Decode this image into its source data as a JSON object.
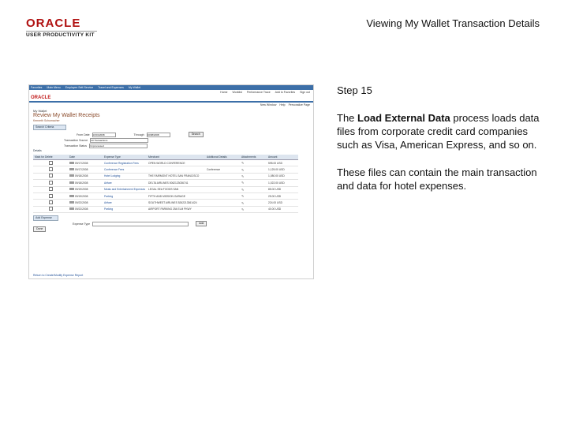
{
  "header": {
    "logo_brand": "ORACLE",
    "logo_sub": "USER PRODUCTIVITY KIT",
    "title": "Viewing My Wallet Transaction Details"
  },
  "side_text": {
    "step": "Step 15",
    "p1_pre": "The ",
    "p1_bold": "Load External Data",
    "p1_post": " process loads data files from corporate credit card companies such as Visa, American Express, and so on.",
    "p2": "These files can contain the main transaction and data for hotel expenses."
  },
  "screenshot": {
    "top_menu": [
      "Favorites",
      "Main Menu",
      "Employee Self-Service",
      "Travel and Expenses",
      "My Wallet"
    ],
    "top_links": [
      "Home",
      "Worklist",
      "Performance Trace",
      "Add to Favorites",
      "Sign out"
    ],
    "brand": "ORACLE",
    "page_links": [
      "New Window",
      "Help",
      "Personalize Page"
    ],
    "crumb": "My Wallet",
    "page_title": "Review My Wallet Receipts",
    "subtitle": "Kenneth Schumacher",
    "search_section": "Search Criteria",
    "from_date_label": "From Date",
    "from_date_value": "10/01/2008",
    "through_label": "Through",
    "through_value": "10/08/2008",
    "search_button": "Search",
    "transaction_source_label": "Transaction Source",
    "transaction_source_value": "All Transactions",
    "transaction_status_label": "Transaction Status",
    "transaction_status_value": "Unprocessed",
    "details_label": "Details",
    "columns": [
      "Mark for Delete",
      "Date",
      "Expense Type",
      "Merchant",
      "Additional Details",
      "Attachments",
      "Amount"
    ],
    "rows": [
      {
        "date": "09/17/2008",
        "type": "Conference Registration Fees",
        "merchant": "OPEN WORLD CONFERENCE",
        "details": "",
        "amount": "595.00 USD"
      },
      {
        "date": "09/17/2008",
        "type": "Conference Fees",
        "merchant": "",
        "details": "Conference",
        "amount": "1,125.00 USD"
      },
      {
        "date": "09/18/2008",
        "type": "Hotel Lodging",
        "merchant": "THE FAIRMONT HOTEL SAN FRANCISCO",
        "details": "",
        "amount": "1,080.00 USD"
      },
      {
        "date": "09/18/2008",
        "type": "Airfare",
        "merchant": "DELTA AIRLINES 0062123036741",
        "details": "",
        "amount": "1,022.00 USD"
      },
      {
        "date": "09/19/2008",
        "type": "Meals and Entertainment Expenses",
        "merchant": "LEGAL SEA FOODS SAN",
        "details": "",
        "amount": "85.00 USD"
      },
      {
        "date": "09/19/2008",
        "type": "Parking",
        "merchant": "FIFTH AND MISSION GARAGE",
        "details": "",
        "amount": "25.00 USD"
      },
      {
        "date": "09/22/2008",
        "type": "Airfare",
        "merchant": "SOUTHWEST AIRLINES 5262213361424",
        "details": "",
        "amount": "224.00 USD"
      },
      {
        "date": "09/22/2008",
        "type": "Parking",
        "merchant": "AIRPORT PARKING 254 ELM PKWY",
        "details": "",
        "amount": "40.00 USD"
      }
    ],
    "add_section": "Add Expense",
    "expense_type_label": "Expense Type",
    "add_button": "Add",
    "done_button": "Done",
    "footer_link": "Return to Create/Modify Expense Report"
  }
}
